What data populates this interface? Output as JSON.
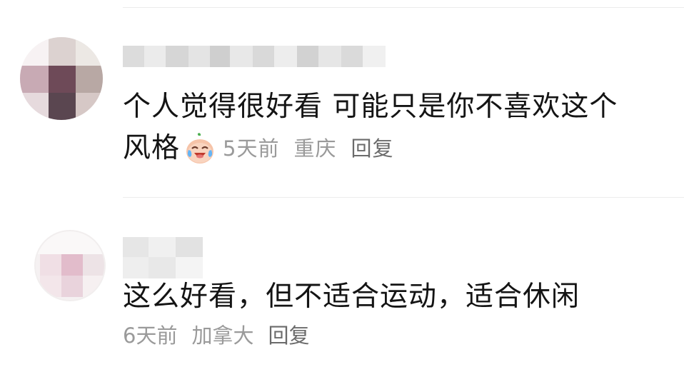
{
  "comments": [
    {
      "text_line1": "个人觉得很好看 可能只是你不喜欢这个",
      "text_line2": "风格",
      "emoji": "laughing-crying-peach-emoji",
      "time": "5天前",
      "location": "重庆",
      "reply_label": "回复"
    },
    {
      "text_line1": "这么好看，但不适合运动，适合休闲",
      "time": "6天前",
      "location": "加拿大",
      "reply_label": "回复"
    }
  ],
  "colors": {
    "comment_text": "#141414",
    "meta_text": "#9a9a9a",
    "reply_text": "#6b6b6b",
    "divider": "#ececec"
  }
}
